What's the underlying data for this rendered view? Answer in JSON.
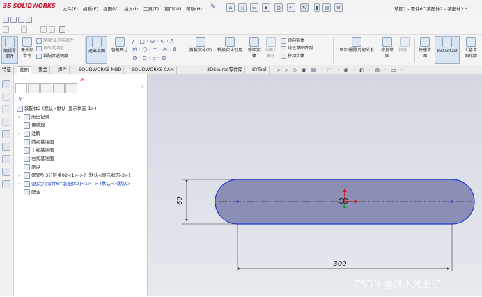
{
  "app": {
    "brand": "SOLIDWORKS",
    "brand_prefix": "3S",
    "doc_title": "草图1 - 零件6^装配体2 - 装配体2 *"
  },
  "menu": [
    "文件(F)",
    "编辑(E)",
    "视图(V)",
    "插入(I)",
    "工具(T)",
    "窗口(W)",
    "帮助(H)"
  ],
  "command_manager": {
    "edit_part": "编辑零\n部件",
    "no_external": "无外部\n参考",
    "hide_show": "隐藏/显示零部件",
    "change_transparency": "更改透明度",
    "assembly_transparency": "装配体透明度",
    "exit_sketch": "退出草图",
    "smart_dimension": "智能尺寸",
    "trim": "剪裁实体(T)",
    "convert": "转换实体引用",
    "offset": "等距实\n体",
    "surface_offset": "曲面上\n偏移",
    "mirror": "镜向实体",
    "linear_pattern": "线性草图阵列",
    "move": "移动实体",
    "show_delete_relations": "显示/删除几何关系",
    "repair_sketch": "修复草\n图",
    "quick_snaps": "快速...",
    "rapid_sketch": "快速草\n图",
    "instant2d": "Instant2D",
    "shaded_contours": "上色草\n图轮廓"
  },
  "tabs": [
    "特征",
    "草图",
    "钣金",
    "焊件",
    "SOLIDWORKS MBD",
    "SOLIDWORKS CAM",
    "3DSource零件库",
    "KYTool"
  ],
  "active_tab": "草图",
  "tree": {
    "root": "装配体2 (默认<默认_显示状态-1>)",
    "items": [
      {
        "label": "历史记录",
        "indent": 1,
        "arrow": "›",
        "color": "normal"
      },
      {
        "label": "传感器",
        "indent": 1,
        "arrow": "",
        "color": "normal"
      },
      {
        "label": "注解",
        "indent": 1,
        "arrow": "›",
        "color": "normal"
      },
      {
        "label": "前视基准面",
        "indent": 1,
        "arrow": "",
        "color": "normal"
      },
      {
        "label": "上视基准面",
        "indent": 1,
        "arrow": "",
        "color": "normal"
      },
      {
        "label": "右视基准面",
        "indent": 1,
        "arrow": "",
        "color": "normal"
      },
      {
        "label": "原点",
        "indent": 1,
        "arrow": "",
        "color": "normal"
      },
      {
        "label": "(固定) 3分链条02<1>->? (默认<显示状态-3>)",
        "indent": 1,
        "arrow": "›",
        "color": "normal"
      },
      {
        "label": "(固定) [零件6^装配体2]<1> -> (默认<<默认>_",
        "indent": 1,
        "arrow": "›",
        "color": "blue"
      },
      {
        "label": "配合",
        "indent": 1,
        "arrow": "",
        "color": "normal"
      }
    ]
  },
  "drawing": {
    "dim_height": "60",
    "dim_length": "300",
    "shape_fill": "#8b8fb5",
    "outline_color": "#2233d6"
  },
  "watermark": "CSDN @技术死肥仔",
  "colors": {
    "brand_red": "#c8102e",
    "graphics_bg_top": "#d3d8e2",
    "tree_blue": "#1c47c9"
  }
}
